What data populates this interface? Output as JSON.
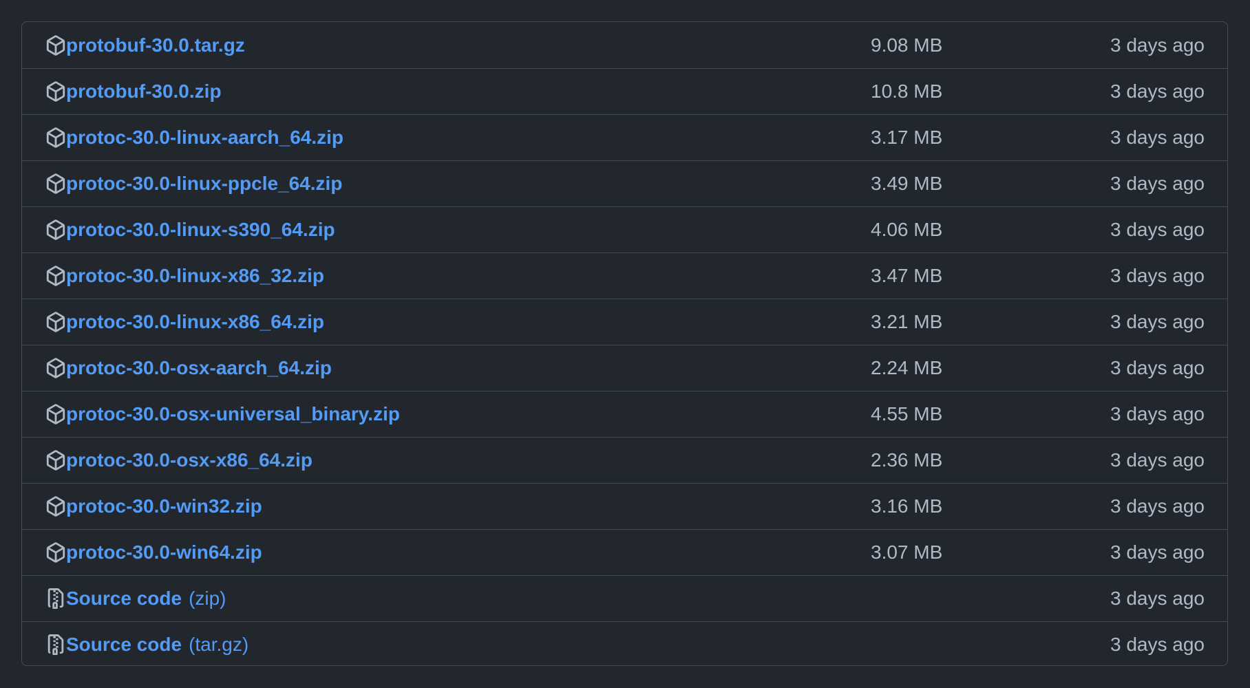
{
  "assets": [
    {
      "name": "protobuf-30.0.tar.gz",
      "suffix": "",
      "icon": "package-icon",
      "size": "9.08 MB",
      "date": "3 days ago"
    },
    {
      "name": "protobuf-30.0.zip",
      "suffix": "",
      "icon": "package-icon",
      "size": "10.8 MB",
      "date": "3 days ago"
    },
    {
      "name": "protoc-30.0-linux-aarch_64.zip",
      "suffix": "",
      "icon": "package-icon",
      "size": "3.17 MB",
      "date": "3 days ago"
    },
    {
      "name": "protoc-30.0-linux-ppcle_64.zip",
      "suffix": "",
      "icon": "package-icon",
      "size": "3.49 MB",
      "date": "3 days ago"
    },
    {
      "name": "protoc-30.0-linux-s390_64.zip",
      "suffix": "",
      "icon": "package-icon",
      "size": "4.06 MB",
      "date": "3 days ago"
    },
    {
      "name": "protoc-30.0-linux-x86_32.zip",
      "suffix": "",
      "icon": "package-icon",
      "size": "3.47 MB",
      "date": "3 days ago"
    },
    {
      "name": "protoc-30.0-linux-x86_64.zip",
      "suffix": "",
      "icon": "package-icon",
      "size": "3.21 MB",
      "date": "3 days ago"
    },
    {
      "name": "protoc-30.0-osx-aarch_64.zip",
      "suffix": "",
      "icon": "package-icon",
      "size": "2.24 MB",
      "date": "3 days ago"
    },
    {
      "name": "protoc-30.0-osx-universal_binary.zip",
      "suffix": "",
      "icon": "package-icon",
      "size": "4.55 MB",
      "date": "3 days ago"
    },
    {
      "name": "protoc-30.0-osx-x86_64.zip",
      "suffix": "",
      "icon": "package-icon",
      "size": "2.36 MB",
      "date": "3 days ago"
    },
    {
      "name": "protoc-30.0-win32.zip",
      "suffix": "",
      "icon": "package-icon",
      "size": "3.16 MB",
      "date": "3 days ago"
    },
    {
      "name": "protoc-30.0-win64.zip",
      "suffix": "",
      "icon": "package-icon",
      "size": "3.07 MB",
      "date": "3 days ago"
    },
    {
      "name": "Source code",
      "suffix": "(zip)",
      "icon": "file-zip-icon",
      "size": "",
      "date": "3 days ago"
    },
    {
      "name": "Source code",
      "suffix": "(tar.gz)",
      "icon": "file-zip-icon",
      "size": "",
      "date": "3 days ago"
    }
  ],
  "colors": {
    "background": "#22272e",
    "border": "#444c56",
    "link": "#539bf5",
    "text": "#adbac7"
  }
}
